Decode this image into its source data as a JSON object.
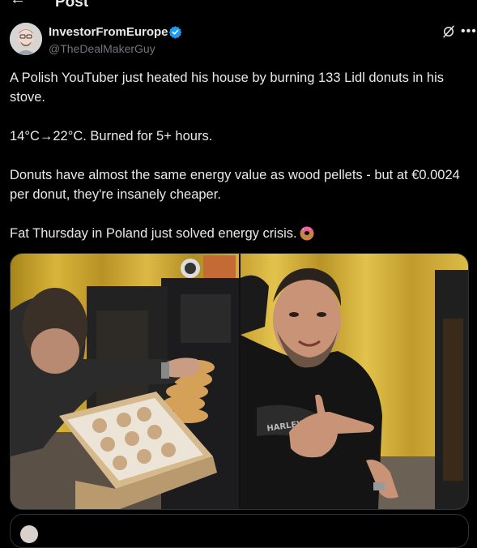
{
  "header": {
    "title": "Post",
    "back_icon": "back-arrow-icon"
  },
  "author": {
    "name": "InvestorFromEurope",
    "handle": "@TheDealMakerGuy",
    "verified_color": "#1d9bf0"
  },
  "tweet": {
    "paragraphs": [
      "A Polish YouTuber just heated his house by burning 133 Lidl donuts in his stove.",
      "14°C→22°C. Burned for 5+ hours.",
      "Donuts have almost the same energy value as wood pellets - but at €0.0024 per donut, they're insanely cheaper.",
      "Fat Thursday in Poland just solved energy crisis."
    ],
    "emoji": "donut-icon"
  },
  "colors": {
    "background": "#000000",
    "text": "#e7e9ea",
    "muted": "#71767b",
    "border": "#2f3336",
    "accent": "#1d9bf0"
  }
}
